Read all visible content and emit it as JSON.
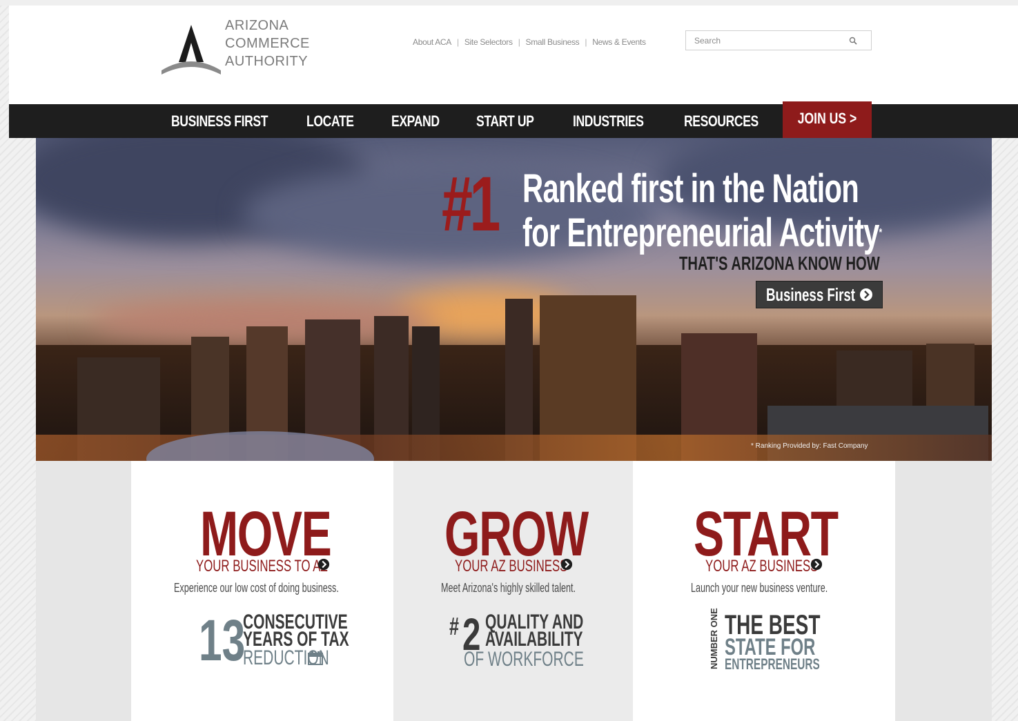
{
  "logo": {
    "line1": "ARIZONA",
    "line2": "COMMERCE",
    "line3": "AUTHORITY"
  },
  "utility_nav": {
    "items": [
      "About ACA",
      "Site Selectors",
      "Small Business",
      "News & Events"
    ]
  },
  "search": {
    "placeholder": "Search",
    "icon": "search-icon"
  },
  "main_nav": {
    "items": [
      "BUSINESS FIRST",
      "LOCATE",
      "EXPAND",
      "START UP",
      "INDUSTRIES",
      "RESOURCES"
    ],
    "join": "JOIN US >"
  },
  "hero": {
    "number": "#1",
    "headline_line1": "Ranked first in the Nation",
    "headline_line2": "for Entrepreneurial Activity",
    "asterisk": "*",
    "tagline": "THAT'S ARIZONA KNOW HOW",
    "button_label": "Business First",
    "credit": "* Ranking Provided by: Fast Company"
  },
  "panels": [
    {
      "word": "MOVE",
      "subline": "YOUR BUSINESS TO AZ",
      "desc": "Experience our low cost of doing business.",
      "stat_number": "13",
      "stat_lines": [
        "CONSECUTIVE",
        "YEARS OF TAX",
        "REDUCTION"
      ]
    },
    {
      "word": "GROW",
      "subline": "YOUR AZ BUSINESS",
      "desc": "Meet Arizona's highly skilled talent.",
      "stat_prefix": "#",
      "stat_number": "2",
      "stat_lines": [
        "QUALITY AND",
        "AVAILABILITY",
        "OF WORKFORCE"
      ]
    },
    {
      "word": "START",
      "subline": "YOUR AZ BUSINESS",
      "desc": "Launch your new business venture.",
      "stat_side": "NUMBER ONE",
      "stat_lines": [
        "THE BEST",
        "STATE FOR",
        "ENTREPRENEURS"
      ]
    }
  ],
  "colors": {
    "brand_red": "#8e1b1b",
    "nav_bg": "#1e1e1e",
    "slate": "#6f8088"
  }
}
